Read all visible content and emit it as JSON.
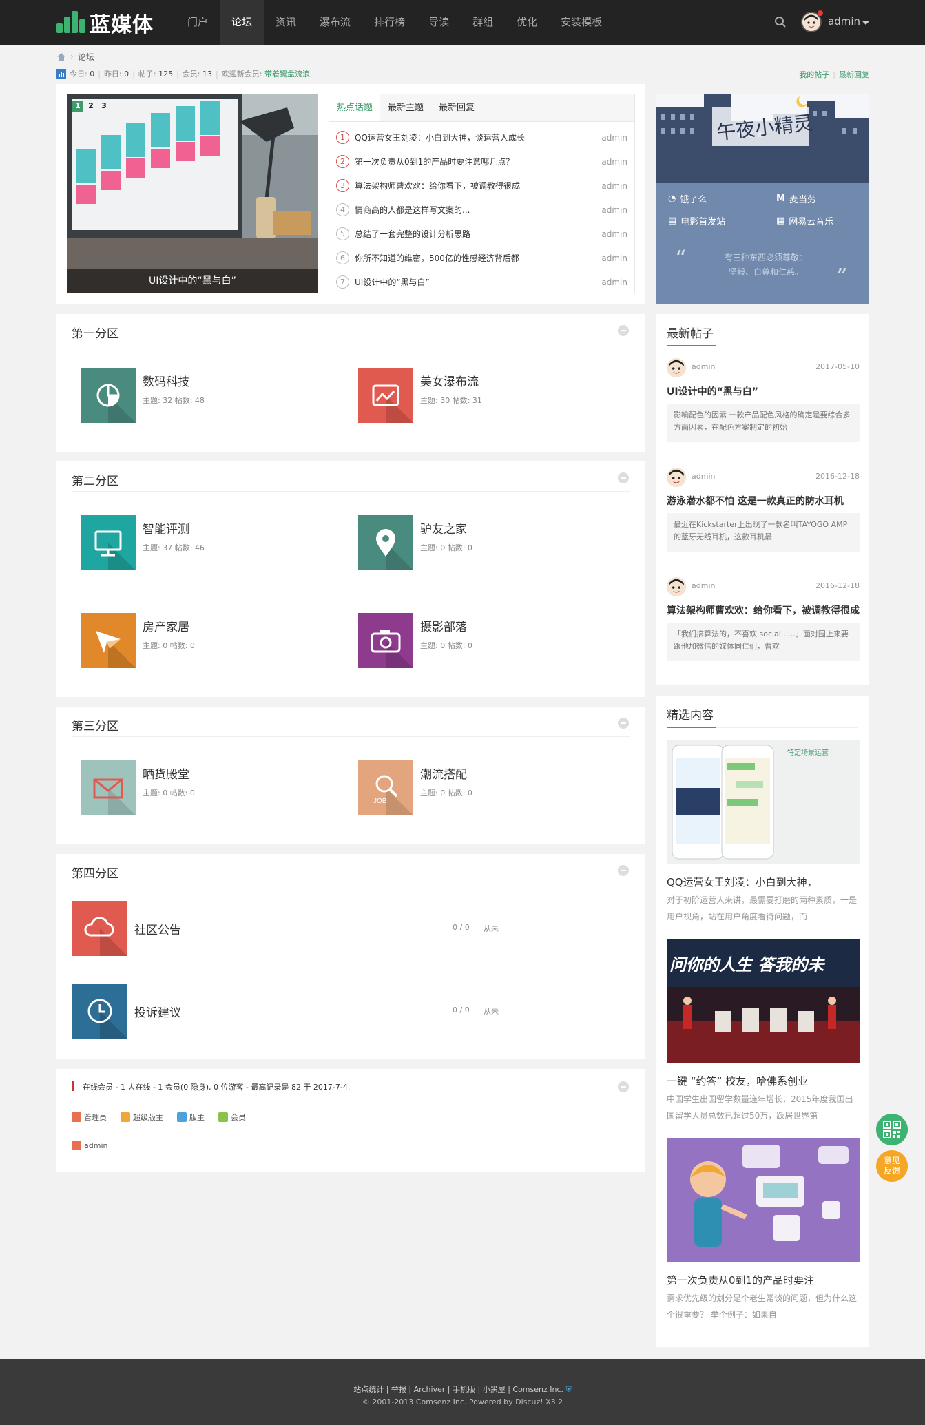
{
  "header": {
    "logo_text": "蓝媒体",
    "nav": [
      "门户",
      "论坛",
      "资讯",
      "瀑布流",
      "排行榜",
      "导读",
      "群组",
      "优化",
      "安装模板"
    ],
    "active_nav": "论坛",
    "user": "admin",
    "accent": "#3cb371"
  },
  "breadcrumb": {
    "current": "论坛"
  },
  "stats": {
    "today_label": "今日:",
    "today": "0",
    "yesterday_label": "昨日:",
    "yesterday": "0",
    "posts_label": "帖子:",
    "posts": "125",
    "members_label": "会员:",
    "members": "13",
    "welcome_label": "欢迎新会员:",
    "new_member": "带着键盘流浪",
    "my_posts": "我的帖子",
    "latest_replies": "最新回复"
  },
  "slideshow": {
    "pages": [
      "1",
      "2",
      "3"
    ],
    "active_page": "1",
    "caption": "UI设计中的“黑与白”"
  },
  "hot": {
    "tabs": [
      "热点话题",
      "最新主题",
      "最新回复"
    ],
    "active_tab": "热点话题",
    "items": [
      {
        "n": "1",
        "title": "QQ运营女王刘凌：小白到大神，谈运营人成长",
        "author": "admin"
      },
      {
        "n": "2",
        "title": "第一次负责从0到1的产品时要注意哪几点？",
        "author": "admin"
      },
      {
        "n": "3",
        "title": "算法架构师曹欢欢：给你看下，被调教得很成",
        "author": "admin"
      },
      {
        "n": "4",
        "title": "情商高的人都是这样写文案的...",
        "author": "admin"
      },
      {
        "n": "5",
        "title": "总结了一套完整的设计分析思路",
        "author": "admin"
      },
      {
        "n": "6",
        "title": "你所不知道的维密，500亿的性感经济背后都",
        "author": "admin"
      },
      {
        "n": "7",
        "title": "UI设计中的“黑与白”",
        "author": "admin"
      }
    ]
  },
  "side_banner": {
    "title": "午夜小精灵",
    "links": [
      "饿了么",
      "麦当劳",
      "电影首发站",
      "网易云音乐"
    ],
    "quote_line1": "有三种东西必须尊敬：",
    "quote_line2": "坚毅、自尊和仁慈。",
    "open_quote": "“",
    "close_quote": "”"
  },
  "sections": [
    {
      "title": "第一分区",
      "forums": [
        {
          "name": "数码科技",
          "meta": "主题: 32 帖数: 48",
          "color": "#4a8b80",
          "icon": "pie-chart-icon"
        },
        {
          "name": "美女瀑布流",
          "meta": "主题: 30 帖数: 31",
          "color": "#e05a4f",
          "icon": "chart-frame-icon"
        }
      ]
    },
    {
      "title": "第二分区",
      "forums": [
        {
          "name": "智能评测",
          "meta": "主题: 37 帖数: 46",
          "color": "#1fa6a0",
          "icon": "monitor-icon"
        },
        {
          "name": "驴友之家",
          "meta": "主题: 0 帖数: 0",
          "color": "#4a8b80",
          "icon": "location-pin-icon"
        },
        {
          "name": "房产家居",
          "meta": "主题: 0 帖数: 0",
          "color": "#e0882a",
          "icon": "paper-plane-icon"
        },
        {
          "name": "摄影部落",
          "meta": "主题: 0 帖数: 0",
          "color": "#8e3b8e",
          "icon": "camera-icon"
        }
      ]
    },
    {
      "title": "第三分区",
      "forums": [
        {
          "name": "晒货殿堂",
          "meta": "主题: 0 帖数: 0",
          "color": "#9ec3bd",
          "icon": "envelope-icon"
        },
        {
          "name": "潮流搭配",
          "meta": "主题: 0 帖数: 0",
          "color": "#e2a57d",
          "icon": "job-search-icon"
        }
      ]
    },
    {
      "title": "第四分区",
      "forums": [
        {
          "name": "社区公告",
          "count": "0 / 0",
          "last": "从未",
          "color": "#e05a4f",
          "icon": "cloud-icon"
        },
        {
          "name": "投诉建议",
          "count": "0 / 0",
          "last": "从未",
          "color": "#2d6e96",
          "icon": "clock-icon"
        }
      ]
    }
  ],
  "online": {
    "text": "在线会员 - 1 人在线 - 1 会员(0 隐身), 0 位游客 - 最高记录是 82 于 2017-7-4.",
    "legend": [
      "管理员",
      "超级版主",
      "版主",
      "会员"
    ],
    "users": [
      "admin"
    ]
  },
  "latest_posts": {
    "title": "最新帖子",
    "items": [
      {
        "author": "admin",
        "date": "2017-05-10",
        "title": "UI设计中的“黑与白”",
        "excerpt": "影响配色的因素 一款产品配色风格的确定是要综合多方面因素，在配色方案制定的初始"
      },
      {
        "author": "admin",
        "date": "2016-12-18",
        "title": "游泳潜水都不怕 这是一款真正的防水耳机",
        "excerpt": "最近在Kickstarter上出现了一款名叫TAYOGO AMP的蓝牙无线耳机，这款耳机最"
      },
      {
        "author": "admin",
        "date": "2016-12-18",
        "title": "算法架构师曹欢欢：给你看下，被调教得很成",
        "excerpt": "「我们搞算法的，不喜欢 social......」面对围上来要跟他加微信的媒体同仁们，曹欢"
      }
    ]
  },
  "featured": {
    "title": "精选内容",
    "items": [
      {
        "title": "QQ运营女王刘凌：小白到大神，",
        "desc": "对于初阶运营人来讲，最需要打磨的两种素质，一是用户视角，站在用户角度看待问题，而",
        "img_text": "特定场景运营"
      },
      {
        "title": "一键 “约答” 校友，哈佛系创业",
        "desc": "中国学生出国留学数量连年增长，2015年度我国出国留学人员总数已超过50万，跃居世界第",
        "img_text": "问你的人生 答我的未"
      },
      {
        "title": "第一次负责从0到1的产品时要注",
        "desc": "需求优先级的划分是个老生常谈的问题，但为什么这个很重要？ 举个例子：如果自",
        "img_text": ""
      }
    ]
  },
  "footer": {
    "links": "站点统计 | 举报 | Archiver | 手机版 | 小黑屋 | Comsenz Inc.",
    "copyright": "© 2001-2013 Comsenz Inc.  Powered by Discuz! X3.2"
  },
  "float_buttons": {
    "qr": "qr-code",
    "feedback_line1": "意见",
    "feedback_line2": "反馈"
  }
}
